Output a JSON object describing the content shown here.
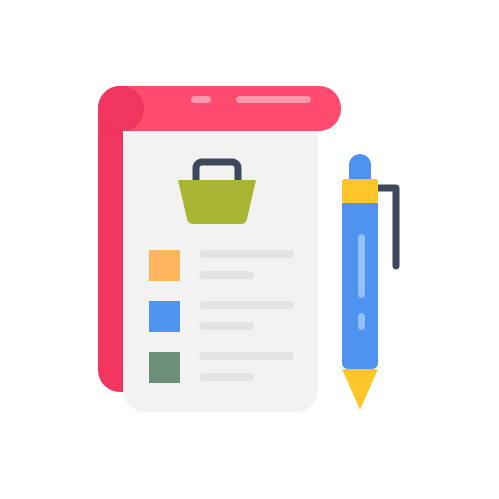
{
  "illustration": {
    "subject": "shopping-list-notepad-with-pen",
    "icons": [
      "notepad-icon",
      "shopping-basket-icon",
      "checkbox-icon",
      "pen-icon"
    ],
    "colors": {
      "binding": "#F0355E",
      "binding_highlight": "#FF4B6E",
      "page": "#F2F2F2",
      "page_lines": "#E3E3E3",
      "basket": "#A9B634",
      "basket_handle": "#3E4A5C",
      "checkbox_1": "#FFB55E",
      "checkbox_2": "#4F93F0",
      "checkbox_3": "#6B8F79",
      "pen_body": "#4F93F0",
      "pen_highlight": "#8FC0FF",
      "pen_band": "#FFC629",
      "pen_clip": "#3E4A5C"
    },
    "checklist": {
      "item_count": 3
    }
  }
}
